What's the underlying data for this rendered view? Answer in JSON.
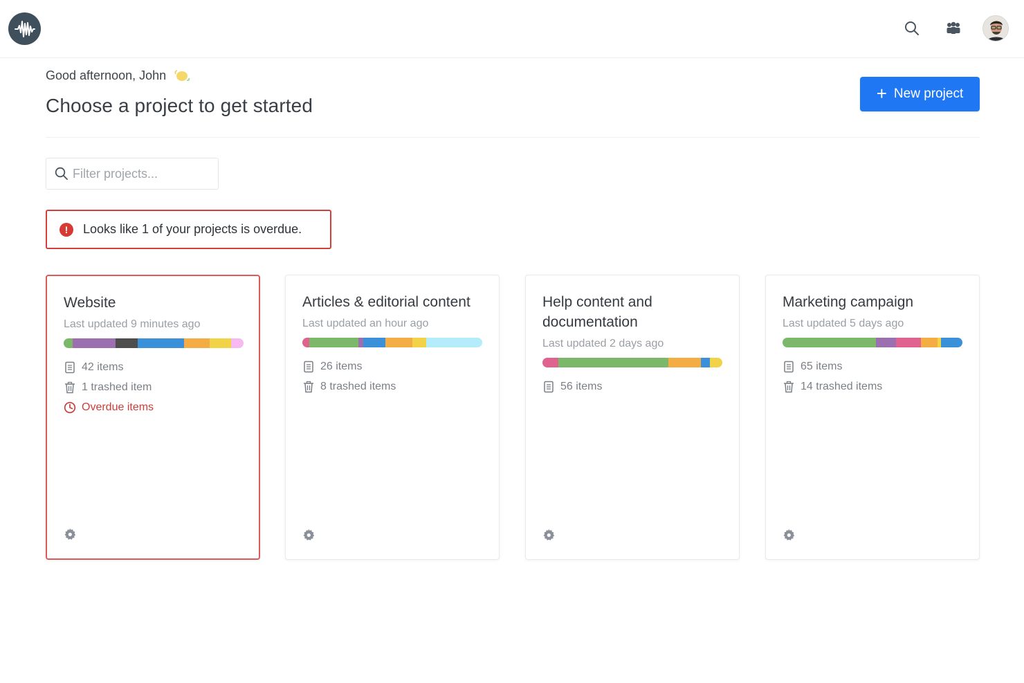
{
  "header": {
    "greeting": "Good afternoon, John",
    "title": "Choose a project to get started",
    "new_project_label": "New project",
    "new_project_icon": "plus-icon"
  },
  "topbar": {
    "logo": "waveform-logo",
    "icons": [
      "search-icon",
      "team-icon"
    ],
    "avatar": "avatar"
  },
  "filter": {
    "placeholder": "Filter projects..."
  },
  "alert": {
    "text": "Looks like 1 of your projects is overdue.",
    "icon": "alert-icon"
  },
  "colors": {
    "accent": "#1f77f3",
    "danger": "#d63a34",
    "green": "#7cb86a",
    "purple": "#9b6fb0",
    "dark": "#4d4d4d",
    "blue": "#3a90d9",
    "orange": "#f4ad45",
    "yellow": "#f2d246",
    "pink": "#f6b9f0",
    "rose": "#e0628f",
    "cyan": "#b5ecfb"
  },
  "projects": [
    {
      "title": "Website",
      "updated": "Last updated 9 minutes ago",
      "items": "42 items",
      "trashed": "1 trashed item",
      "overdue": "Overdue items",
      "bar": [
        {
          "color": "#7cb86a",
          "share": 5
        },
        {
          "color": "#9b6fb0",
          "share": 24
        },
        {
          "color": "#4d4d4d",
          "share": 12
        },
        {
          "color": "#3a90d9",
          "share": 26
        },
        {
          "color": "#f4ad45",
          "share": 14
        },
        {
          "color": "#f2d246",
          "share": 12
        },
        {
          "color": "#f6b9f0",
          "share": 7
        }
      ]
    },
    {
      "title": "Articles & editorial content",
      "updated": "Last updated an hour ago",
      "items": "26 items",
      "trashed": "8 trashed items",
      "bar": [
        {
          "color": "#e0628f",
          "share": 4
        },
        {
          "color": "#7cb86a",
          "share": 27
        },
        {
          "color": "#9b6fb0",
          "share": 3
        },
        {
          "color": "#3a90d9",
          "share": 12
        },
        {
          "color": "#f4ad45",
          "share": 15
        },
        {
          "color": "#f2d246",
          "share": 8
        },
        {
          "color": "#b5ecfb",
          "share": 31
        }
      ]
    },
    {
      "title": "Help content and documentation",
      "updated": "Last updated 2 days ago",
      "items": "56 items",
      "bar": [
        {
          "color": "#e0628f",
          "share": 9
        },
        {
          "color": "#7cb86a",
          "share": 61
        },
        {
          "color": "#f4ad45",
          "share": 18
        },
        {
          "color": "#3a90d9",
          "share": 5
        },
        {
          "color": "#f2d246",
          "share": 7
        }
      ]
    },
    {
      "title": "Marketing campaign",
      "updated": "Last updated 5 days ago",
      "items": "65 items",
      "trashed": "14 trashed items",
      "bar": [
        {
          "color": "#7cb86a",
          "share": 52
        },
        {
          "color": "#9b6fb0",
          "share": 11
        },
        {
          "color": "#e0628f",
          "share": 14
        },
        {
          "color": "#f4ad45",
          "share": 9
        },
        {
          "color": "#f2d246",
          "share": 2
        },
        {
          "color": "#3a90d9",
          "share": 12
        }
      ]
    }
  ]
}
